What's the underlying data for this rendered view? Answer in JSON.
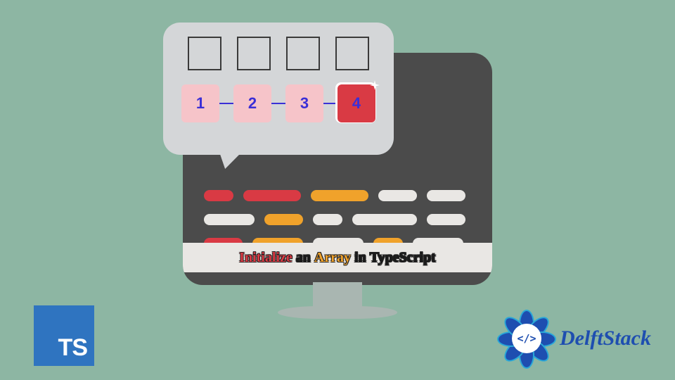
{
  "bubble": {
    "box_count": 4,
    "numbers": [
      "1",
      "2",
      "3",
      "4"
    ]
  },
  "title": {
    "word1": "Initialize",
    "word2": "an",
    "word3": "Array",
    "word4": "in",
    "word5": "TypeScript"
  },
  "ts_badge": {
    "label": "TS"
  },
  "delft": {
    "code_glyph": "</>",
    "brand": "DelftStack"
  },
  "colors": {
    "bg": "#8db6a3",
    "monitor": "#4b4b4b",
    "red": "#d93a44",
    "orange": "#f0a22b",
    "white": "#e9e7e4",
    "bubble": "#d4d6d8",
    "pink": "#f6c4c9",
    "num_text": "#3b2fd6",
    "ts_blue": "#2f74c0",
    "delft_blue": "#1e4eb0"
  }
}
